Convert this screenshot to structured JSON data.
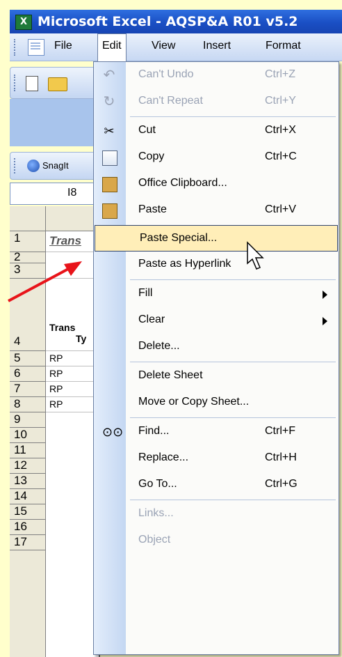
{
  "window": {
    "title": "Microsoft Excel - AQSP&A R01 v5.2",
    "app_icon": "excel-icon"
  },
  "menubar": {
    "items": [
      {
        "label": "File"
      },
      {
        "label": "Edit"
      },
      {
        "label": "View"
      },
      {
        "label": "Insert"
      },
      {
        "label": "Format"
      }
    ]
  },
  "toolbar": {
    "snagit_label": "SnagIt"
  },
  "namebox": {
    "value": "I8"
  },
  "grid": {
    "rows": [
      "1",
      "2",
      "3",
      "4",
      "5",
      "6",
      "7",
      "8",
      "9",
      "10",
      "11",
      "12",
      "13",
      "14",
      "15",
      "16",
      "17"
    ],
    "cells": {
      "r1": "Trans",
      "r4a": "Trans",
      "r4b": "Ty",
      "r5": "RP",
      "r6": "RP",
      "r7": "RP",
      "r8": "RP"
    }
  },
  "edit_menu": {
    "undo": {
      "label": "Can't Undo",
      "shortcut": "Ctrl+Z"
    },
    "repeat": {
      "label": "Can't Repeat",
      "shortcut": "Ctrl+Y"
    },
    "cut": {
      "label": "Cut",
      "shortcut": "Ctrl+X"
    },
    "copy": {
      "label": "Copy",
      "shortcut": "Ctrl+C"
    },
    "office_clipboard": {
      "label": "Office Clipboard..."
    },
    "paste": {
      "label": "Paste",
      "shortcut": "Ctrl+V"
    },
    "paste_special": {
      "label": "Paste Special..."
    },
    "paste_hyperlink": {
      "label": "Paste as Hyperlink"
    },
    "fill": {
      "label": "Fill"
    },
    "clear": {
      "label": "Clear"
    },
    "delete": {
      "label": "Delete..."
    },
    "delete_sheet": {
      "label": "Delete Sheet"
    },
    "move_copy": {
      "label": "Move or Copy Sheet..."
    },
    "find": {
      "label": "Find...",
      "shortcut": "Ctrl+F"
    },
    "replace": {
      "label": "Replace...",
      "shortcut": "Ctrl+H"
    },
    "goto": {
      "label": "Go To...",
      "shortcut": "Ctrl+G"
    },
    "links": {
      "label": "Links..."
    },
    "object": {
      "label": "Object"
    }
  },
  "colors": {
    "highlight": "#ffeeb8",
    "arrow": "#e8141a",
    "background": "#ffffcc"
  }
}
